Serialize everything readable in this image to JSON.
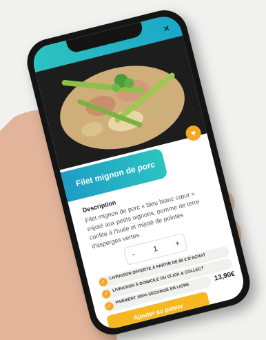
{
  "dish": {
    "title": "Filet mignon de porc",
    "description_heading": "Description",
    "description": "Filet mignon de porc « bleu blanc cœur » mijoté aux petits oignons, pomme de terre confite à l'huile et mijoté de pointes d'asperges vertes.",
    "quantity": "1",
    "price": "13,90€"
  },
  "controls": {
    "close": "×",
    "minus": "-",
    "plus": "+",
    "add_to_cart": "Ajouter au panier"
  },
  "info": [
    "Livraison offerte à partir de 80 € d'achat",
    "Livraison à domicile ou click & collect",
    "Paiement 100% sécurisé en ligne"
  ],
  "icons": {
    "heart": "heart-icon",
    "check": "check-icon"
  },
  "colors": {
    "accent_teal": "#2cc4c0",
    "accent_blue": "#1ba7c8",
    "accent_yellow": "#f6b722"
  }
}
